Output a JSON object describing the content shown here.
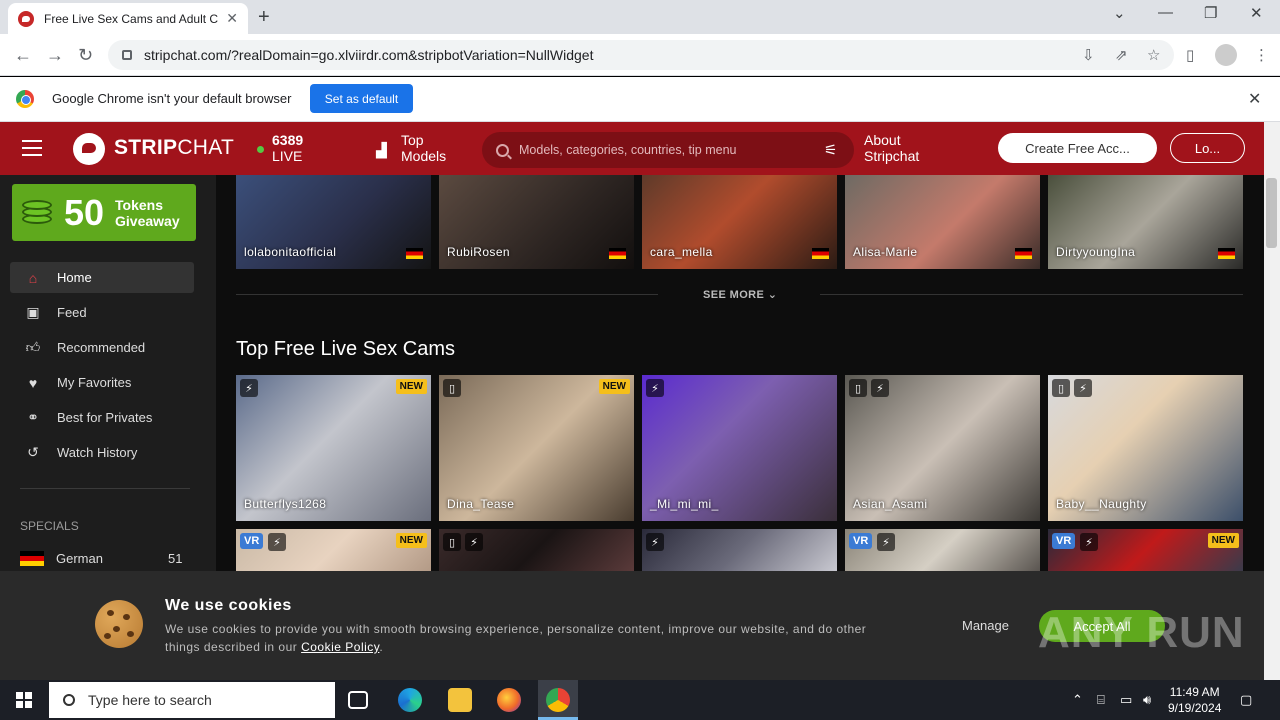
{
  "browser": {
    "tab_title": "Free Live Sex Cams and Adult Chat",
    "url": "stripchat.com/?realDomain=go.xlviirdr.com&stripbotVariation=NullWidget",
    "infobar_text": "Google Chrome isn't your default browser",
    "set_default_label": "Set as default"
  },
  "header": {
    "logo_bold": "STRIP",
    "logo_light": "CHAT",
    "live_count": "6389",
    "live_label": "LIVE",
    "top_models_line1": "Top",
    "top_models_line2": "Models",
    "search_placeholder": "Models, categories, countries, tip menu",
    "about_line1": "About",
    "about_line2": "Stripchat",
    "create_label": "Create Free Acc...",
    "login_label": "Lo..."
  },
  "sidebar": {
    "giveaway_number": "50",
    "giveaway_line1": "Tokens",
    "giveaway_line2": "Giveaway",
    "items": [
      {
        "label": "Home",
        "icon": "home-icon"
      },
      {
        "label": "Feed",
        "icon": "feed-icon"
      },
      {
        "label": "Recommended",
        "icon": "thumbs-up-icon"
      },
      {
        "label": "My Favorites",
        "icon": "heart-icon"
      },
      {
        "label": "Best for Privates",
        "icon": "privates-icon"
      },
      {
        "label": "Watch History",
        "icon": "history-icon"
      }
    ],
    "specials_label": "SPECIALS",
    "specials": [
      {
        "label": "German",
        "count": "51"
      }
    ]
  },
  "content": {
    "top_row": [
      {
        "name": "lolabonitaofficial"
      },
      {
        "name": "RubiRosen"
      },
      {
        "name": "cara_mella"
      },
      {
        "name": "Alisa-Marie"
      },
      {
        "name": "DirtyyoungIna"
      }
    ],
    "see_more": "SEE MORE",
    "section_title": "Top Free Live Sex Cams",
    "cams_row1": [
      {
        "name": "Butterflys1268",
        "new": "NEW"
      },
      {
        "name": "Dina_Tease",
        "new": "NEW"
      },
      {
        "name": "_Mi_mi_mi_",
        "new": ""
      },
      {
        "name": "Asian_Asami",
        "new": ""
      },
      {
        "name": "Baby__Naughty",
        "new": ""
      }
    ],
    "cams_row2_badges": [
      {
        "vr": "VR",
        "new": "NEW"
      },
      {
        "vr": "",
        "new": ""
      },
      {
        "vr": "",
        "new": ""
      },
      {
        "vr": "VR",
        "new": ""
      },
      {
        "vr": "VR",
        "new": "NEW"
      }
    ]
  },
  "cookie": {
    "title": "We use cookies",
    "text": "We use cookies to provide you with smooth browsing experience, personalize content, improve our website, and do other things described in our",
    "link": "Cookie Policy",
    "manage": "Manage",
    "accept": "Accept All",
    "watermark": "ANY RUN"
  },
  "taskbar": {
    "search_placeholder": "Type here to search",
    "time": "11:49 AM",
    "date": "9/19/2024"
  }
}
